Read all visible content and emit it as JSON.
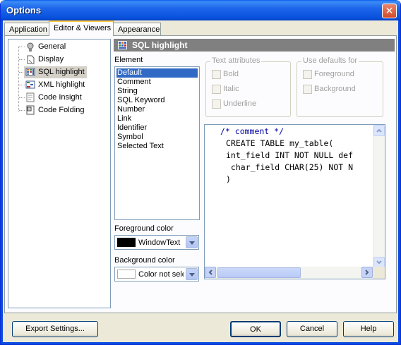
{
  "window": {
    "title": "Options",
    "close_symbol": "✕"
  },
  "tabs": [
    {
      "label": "Application",
      "active": false
    },
    {
      "label": "Editor & Viewers",
      "active": true
    },
    {
      "label": "Appearance",
      "active": false
    }
  ],
  "tree": {
    "items": [
      {
        "label": "General",
        "icon": "general-icon",
        "selected": false
      },
      {
        "label": "Display",
        "icon": "display-icon",
        "selected": false
      },
      {
        "label": "SQL highlight",
        "icon": "sql-highlight-icon",
        "selected": true
      },
      {
        "label": "XML highlight",
        "icon": "xml-highlight-icon",
        "selected": false
      },
      {
        "label": "Code Insight",
        "icon": "code-insight-icon",
        "selected": false
      },
      {
        "label": "Code Folding",
        "icon": "code-folding-icon",
        "selected": false
      }
    ]
  },
  "section": {
    "title": "SQL highlight",
    "icon": "grid-icon"
  },
  "element": {
    "label": "Element",
    "items": [
      "Default",
      "Comment",
      "String",
      "SQL Keyword",
      "Number",
      "Link",
      "Identifier",
      "Symbol",
      "Selected Text"
    ],
    "selected": "Default"
  },
  "text_attributes": {
    "label": "Text attributes",
    "options": [
      "Bold",
      "Italic",
      "Underline"
    ]
  },
  "use_defaults": {
    "label": "Use defaults for",
    "options": [
      "Foreground",
      "Background"
    ]
  },
  "foreground": {
    "label": "Foreground color",
    "value": "WindowText",
    "swatch": "#000000"
  },
  "background": {
    "label": "Background color",
    "value": "Color not sele",
    "swatch": "#ffffff"
  },
  "preview": {
    "lines": [
      "/* comment */",
      "CREATE TABLE my_table(",
      "int_field INT NOT NULL def",
      " char_field CHAR(25) NOT N",
      ")"
    ]
  },
  "buttons": {
    "export": "Export Settings...",
    "ok": "OK",
    "cancel": "Cancel",
    "help": "Help"
  },
  "colors": {
    "title_blue": "#0a5df0",
    "selection": "#316ac5",
    "header_gray": "#808080"
  }
}
